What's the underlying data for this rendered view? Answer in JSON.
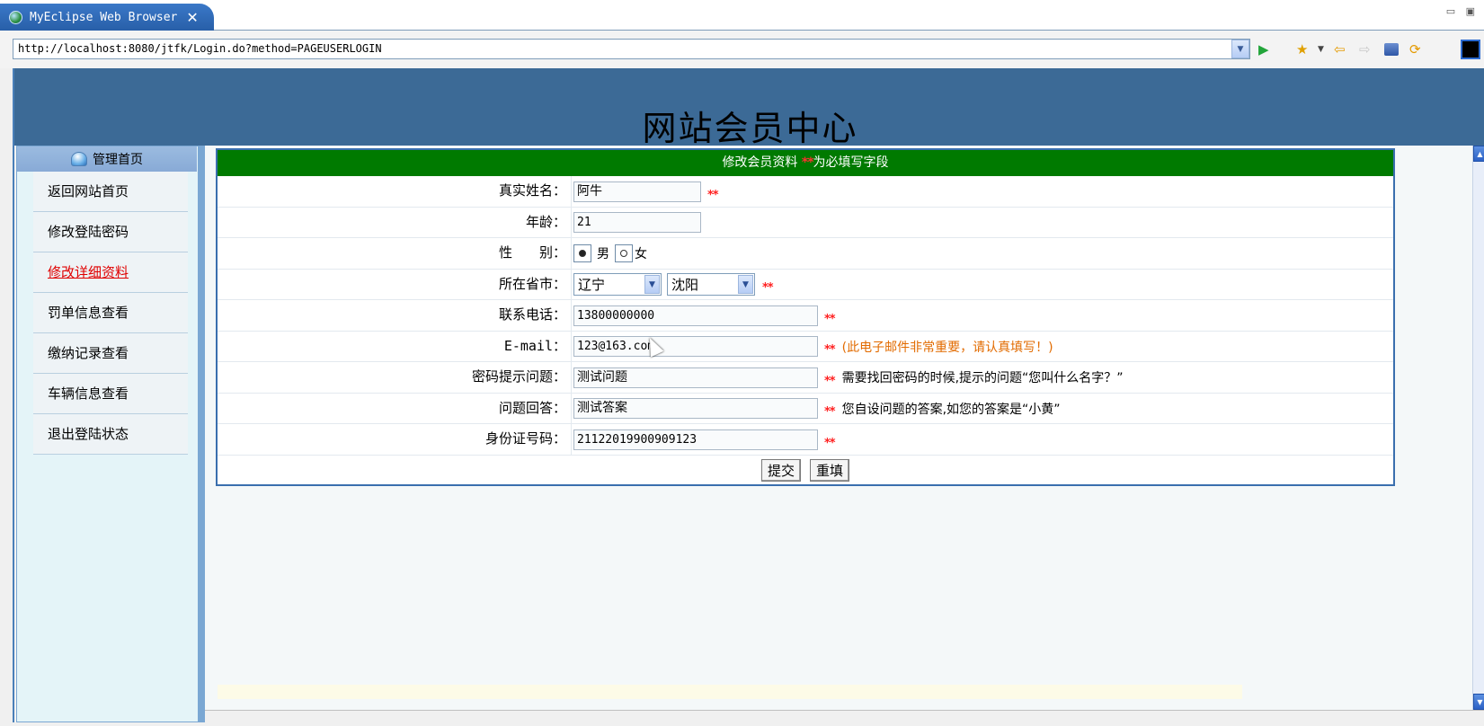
{
  "window": {
    "tab_title": "MyEclipse Web Browser",
    "close_glyph": "✕",
    "view_controls": "▭ ▣"
  },
  "address_bar": {
    "url": "http://localhost:8080/jtfk/Login.do?method=PAGEUSERLOGIN"
  },
  "toolbar_icons": [
    "go-icon",
    "favorites-icon",
    "back-icon",
    "forward-icon",
    "stop-icon",
    "refresh-icon"
  ],
  "header": {
    "site_title": "网站会员中心"
  },
  "sidebar": {
    "heading": "管理首页",
    "items": [
      {
        "label": "返回网站首页"
      },
      {
        "label": "修改登陆密码"
      },
      {
        "label": "修改详细资料"
      },
      {
        "label": "罚单信息查看"
      },
      {
        "label": "缴纳记录查看"
      },
      {
        "label": "车辆信息查看"
      },
      {
        "label": "退出登陆状态"
      }
    ],
    "active_index": 2
  },
  "form": {
    "title": "修改会员资料",
    "required_mark": "**",
    "required_text": "为必填写字段",
    "fields": {
      "real_name": {
        "label": "真实姓名：",
        "value": "阿牛"
      },
      "age": {
        "label": "年龄：",
        "value": "21"
      },
      "gender": {
        "label": "性　　别：",
        "option_male": "男",
        "option_female": "女",
        "selected": "男"
      },
      "region": {
        "label": "所在省市：",
        "province": "辽宁",
        "city": "沈阳"
      },
      "phone": {
        "label": "联系电话：",
        "value": "13800000000"
      },
      "email": {
        "label": "E-mail：",
        "value": "123@163.com",
        "note": "(此电子邮件非常重要，请认真填写！)"
      },
      "question": {
        "label": "密码提示问题：",
        "value": "测试问题",
        "note": "需要找回密码的时候,提示的问题“您叫什么名字？”"
      },
      "answer": {
        "label": "问题回答：",
        "value": "测试答案",
        "note": "您自设问题的答案,如您的答案是“小黄”"
      },
      "id_number": {
        "label": "身份证号码：",
        "value": "211220199009091​23"
      }
    },
    "submit_label": "提交",
    "reset_label": "重填"
  },
  "colors": {
    "header_bg": "#3c6a96",
    "form_header_bg": "#007a00",
    "required_red": "#ff2020",
    "note_orange": "#e26b00",
    "active_menu_red": "#e00000"
  }
}
